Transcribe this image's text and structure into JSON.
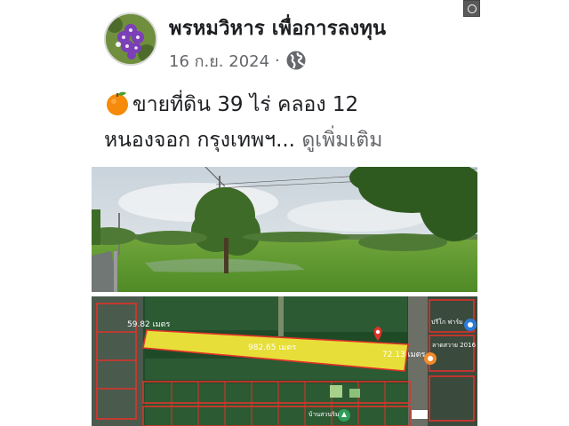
{
  "post": {
    "page_name": "พรหมวิหาร เพื่อการลงทุน",
    "date": "16 ก.ย. 2024",
    "separator": "·",
    "audience_icon": "globe-icon",
    "text_line1": "ขายที่ดิน 39 ไร่ คลอง 12",
    "text_line2": "หนองจอก กรุงเทพฯ...",
    "see_more": "ดูเพิ่มเติม",
    "emoji_icon": "orange-emoji-icon"
  },
  "map": {
    "label_left": "59.82 เมตร",
    "label_center": "982.65 เมตร",
    "label_right": "72.13 เมตร",
    "label_top_right": "ปรีโก ฟาร์ม",
    "label_right_sub": "ลาดสวาย 2016",
    "label_bottom": "บ้านสวนริม"
  },
  "colors": {
    "text_primary": "#1c1e21",
    "text_secondary": "#65676b",
    "plot_highlight": "#f2e63a",
    "boundary": "#e0322a"
  }
}
